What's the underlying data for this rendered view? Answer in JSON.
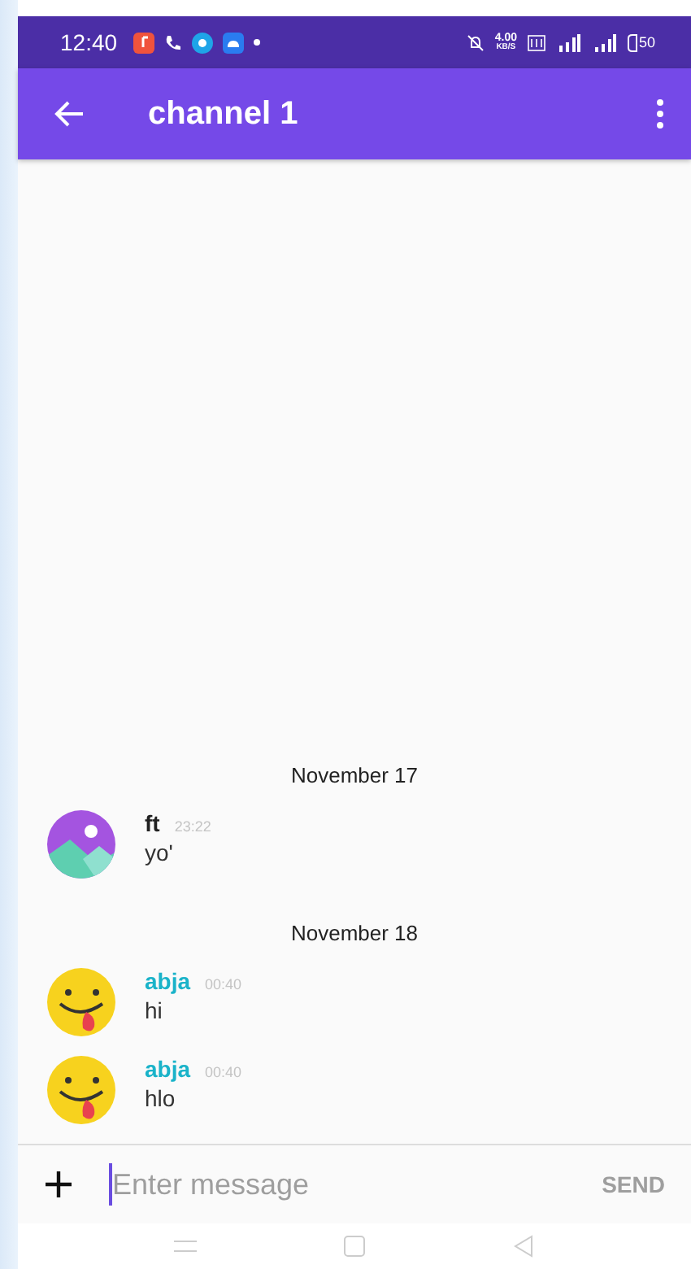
{
  "status_bar": {
    "time": "12:40",
    "speed": "4.00",
    "speed_unit": "KB/S",
    "battery": "50"
  },
  "app_bar": {
    "title": "channel 1"
  },
  "days": [
    {
      "date": "November 17",
      "messages": [
        {
          "author": "ft",
          "time": "23:22",
          "text": "yo'",
          "kind": "picture",
          "color": "#212121"
        }
      ]
    },
    {
      "date": "November 18",
      "messages": [
        {
          "author": "abja",
          "time": "00:40",
          "text": "hi",
          "kind": "emoji",
          "color": "#1ab3c9"
        },
        {
          "author": "abja",
          "time": "00:40",
          "text": "hlo",
          "kind": "emoji",
          "color": "#1ab3c9"
        }
      ]
    }
  ],
  "composer": {
    "placeholder": "Enter message",
    "send": "SEND"
  }
}
